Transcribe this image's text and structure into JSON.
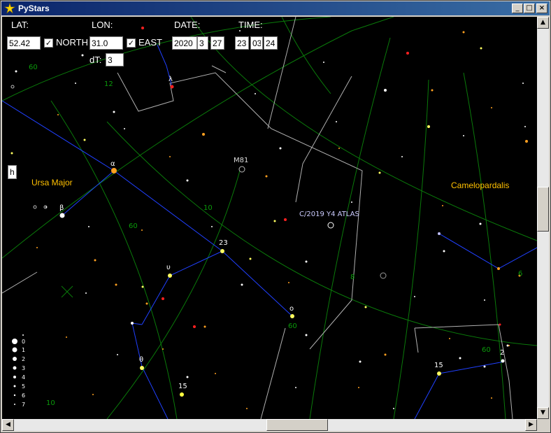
{
  "window": {
    "title": "PyStars",
    "minimize_glyph": "_",
    "maximize_glyph": "□",
    "close_glyph": "×"
  },
  "controls": {
    "lat_label": "LAT:",
    "lat_value": "52.42",
    "north_label": "NORTH",
    "lon_label": "LON:",
    "lon_value": "31.0",
    "east_label": "EAST",
    "date_label": "DATE:",
    "date_year": "2020",
    "date_month": "3",
    "date_day": "27",
    "time_label": "TIME:",
    "time_hour": "23",
    "time_min": "03",
    "time_sec": "24",
    "dt_label": "dT:",
    "dt_value": "3",
    "north_checked": true,
    "east_checked": true,
    "check_glyph": "✓"
  },
  "help_box": "h",
  "labels": {
    "constellations": [
      "Ursa Major",
      "Camelopardalis"
    ],
    "objects": [
      "M81",
      "C/2019 Y4 ATLAS"
    ],
    "stars": [
      "α",
      "β",
      "23",
      "υ",
      "ο",
      "θ",
      "15",
      "15",
      "2",
      "λ"
    ],
    "grid": [
      "60",
      "12",
      "60",
      "10",
      "60",
      "8",
      "6",
      "60",
      "10"
    ]
  },
  "legend": [
    "0",
    "1",
    "2",
    "3",
    "4",
    "5",
    "6",
    "7"
  ],
  "colors": {
    "constellation_label": "#ffc000",
    "grid": "#0a7a0a",
    "lines": "#2040ff",
    "boundaries": "#b0b0b0"
  }
}
